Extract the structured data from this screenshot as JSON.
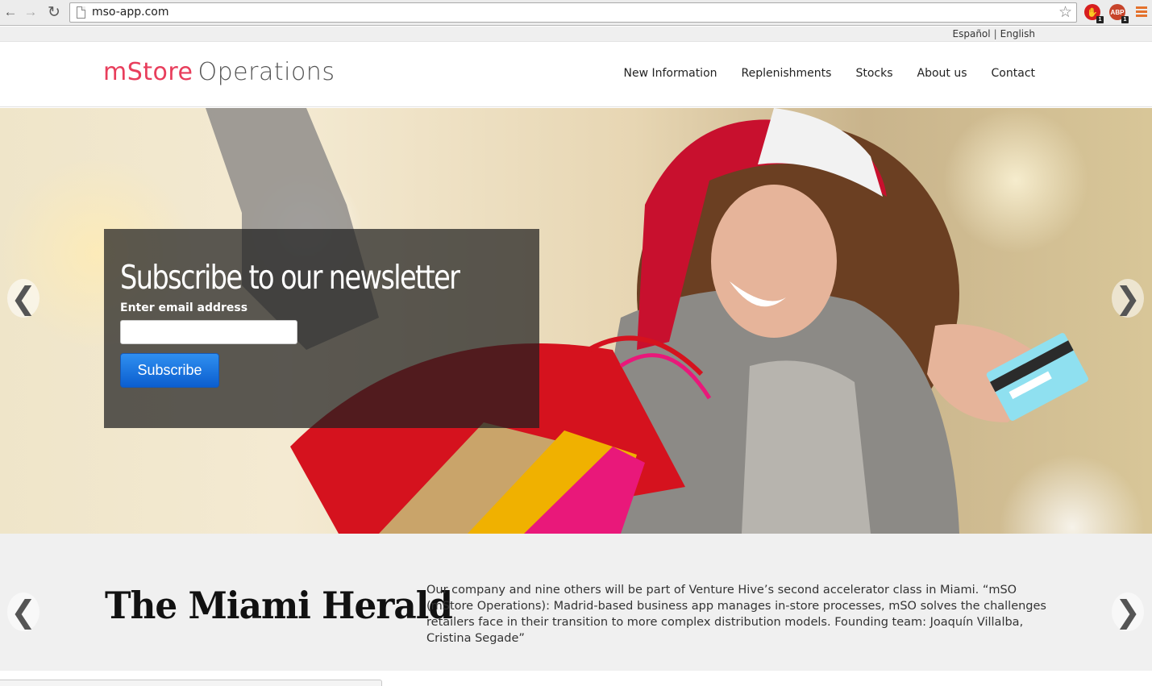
{
  "browser": {
    "url": "mso-app.com",
    "extensions": [
      {
        "name": "stop-extension",
        "label": "",
        "badge": "1"
      },
      {
        "name": "adblock-extension",
        "label": "ABP",
        "badge": "1"
      }
    ]
  },
  "language_bar": {
    "spanish": "Español",
    "separator": "|",
    "english": "English"
  },
  "header": {
    "logo_brand": "mStore",
    "logo_suffix": "Operations",
    "nav": [
      {
        "label": "New Information"
      },
      {
        "label": "Replenishments"
      },
      {
        "label": "Stocks"
      },
      {
        "label": "About us"
      },
      {
        "label": "Contact"
      }
    ]
  },
  "hero": {
    "newsletter": {
      "title": "Subscribe to our newsletter",
      "email_label": "Enter email address",
      "email_value": "",
      "button_label": "Subscribe"
    },
    "prev_arrow": "❮",
    "next_arrow": "❯"
  },
  "press": {
    "publication": "The Miami Herald",
    "quote": "Our company and nine others will be part of Venture Hive’s second accelerator class in Miami. “mSO (mStore Operations): Madrid-based business app manages in-store processes, mSO solves the challenges retailers face in their transition to more complex distribution models. Founding team: Joaquín Villalba, Cristina Segade”",
    "prev_arrow": "❮",
    "next_arrow": "❯"
  },
  "colors": {
    "brand": "#e83e5c",
    "button": "#0b5ecf"
  }
}
